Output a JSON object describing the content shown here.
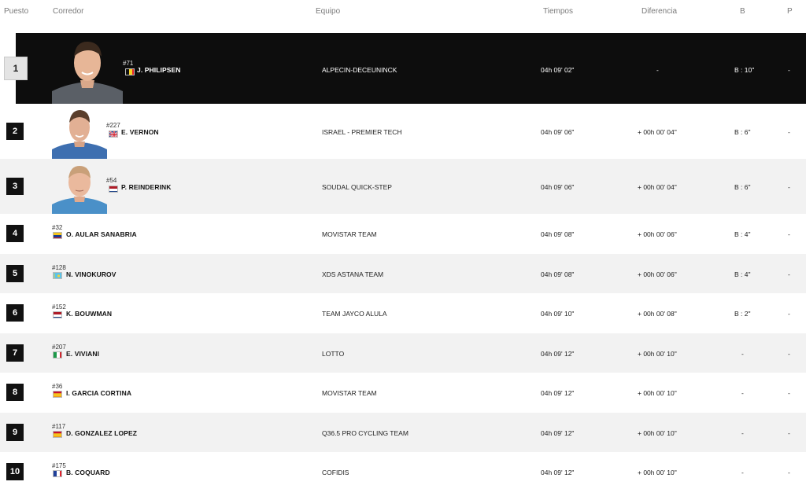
{
  "columns": {
    "puesto": "Puesto",
    "corredor": "Corredor",
    "equipo": "Equipo",
    "tiempos": "Tiempos",
    "diferencia": "Diferencia",
    "b": "B",
    "p": "P"
  },
  "rows": [
    {
      "pos": "1",
      "bib": "#71",
      "name": "J. PHILIPSEN",
      "flag": "belgium",
      "team": "ALPECIN-DECEUNINCK",
      "time": "04h 09' 02\"",
      "diff": "-",
      "bonus": "B : 10\"",
      "points": "-"
    },
    {
      "pos": "2",
      "bib": "#227",
      "name": "E. VERNON",
      "flag": "united-kingdom",
      "team": "ISRAEL - PREMIER TECH",
      "time": "04h 09' 06\"",
      "diff": "+ 00h 00' 04\"",
      "bonus": "B : 6\"",
      "points": "-"
    },
    {
      "pos": "3",
      "bib": "#54",
      "name": "P. REINDERINK",
      "flag": "netherlands",
      "team": "SOUDAL QUICK-STEP",
      "time": "04h 09' 06\"",
      "diff": "+ 00h 00' 04\"",
      "bonus": "B : 6\"",
      "points": "-"
    },
    {
      "pos": "4",
      "bib": "#32",
      "name": "O. AULAR SANABRIA",
      "flag": "venezuela",
      "team": "MOVISTAR TEAM",
      "time": "04h 09' 08\"",
      "diff": "+ 00h 00' 06\"",
      "bonus": "B : 4\"",
      "points": "-"
    },
    {
      "pos": "5",
      "bib": "#128",
      "name": "N. VINOKUROV",
      "flag": "kazakhstan",
      "team": "XDS ASTANA TEAM",
      "time": "04h 09' 08\"",
      "diff": "+ 00h 00' 06\"",
      "bonus": "B : 4\"",
      "points": "-"
    },
    {
      "pos": "6",
      "bib": "#152",
      "name": "K. BOUWMAN",
      "flag": "netherlands",
      "team": "TEAM JAYCO ALULA",
      "time": "04h 09' 10\"",
      "diff": "+ 00h 00' 08\"",
      "bonus": "B : 2\"",
      "points": "-"
    },
    {
      "pos": "7",
      "bib": "#207",
      "name": "E. VIVIANI",
      "flag": "italy",
      "team": "LOTTO",
      "time": "04h 09' 12\"",
      "diff": "+ 00h 00' 10\"",
      "bonus": "-",
      "points": "-"
    },
    {
      "pos": "8",
      "bib": "#36",
      "name": "I. GARCIA CORTINA",
      "flag": "spain",
      "team": "MOVISTAR TEAM",
      "time": "04h 09' 12\"",
      "diff": "+ 00h 00' 10\"",
      "bonus": "-",
      "points": "-"
    },
    {
      "pos": "9",
      "bib": "#117",
      "name": "D. GONZALEZ LOPEZ",
      "flag": "spain",
      "team": "Q36.5 PRO CYCLING TEAM",
      "time": "04h 09' 12\"",
      "diff": "+ 00h 00' 10\"",
      "bonus": "-",
      "points": "-"
    },
    {
      "pos": "10",
      "bib": "#175",
      "name": "B. COQUARD",
      "flag": "france",
      "team": "COFIDIS",
      "time": "04h 09' 12\"",
      "diff": "+ 00h 00' 10\"",
      "bonus": "-",
      "points": "-"
    }
  ]
}
